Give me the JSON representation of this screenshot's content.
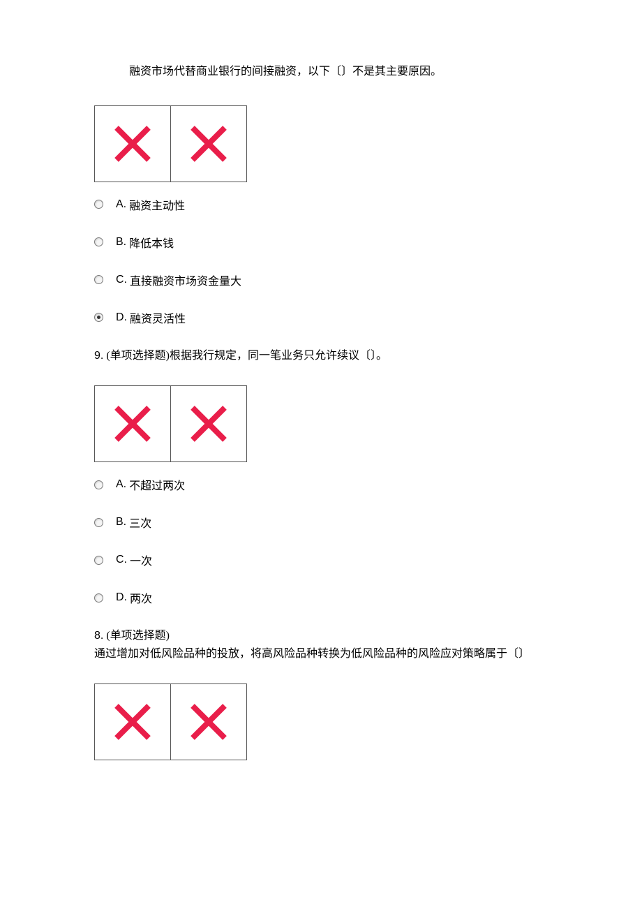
{
  "q1": {
    "intro": "融资市场代替商业银行的间接融资，以下〔〕不是其主要原因。",
    "options": [
      {
        "label": "A.",
        "text": "融资主动性",
        "selected": false
      },
      {
        "label": "B.",
        "text": "降低本钱",
        "selected": false
      },
      {
        "label": "C.",
        "text": "直接融资市场资金量大",
        "selected": false
      },
      {
        "label": "D.",
        "text": "融资灵活性",
        "selected": true
      }
    ]
  },
  "q2": {
    "number": "9.",
    "type": "(单项选择题)",
    "text": "根据我行规定，同一笔业务只允许续议〔〕。",
    "options": [
      {
        "label": "A.",
        "text": "不超过两次",
        "selected": false
      },
      {
        "label": "B.",
        "text": "三次",
        "selected": false
      },
      {
        "label": "C.",
        "text": "一次",
        "selected": false
      },
      {
        "label": "D.",
        "text": "两次",
        "selected": false
      }
    ]
  },
  "q3": {
    "number": "8.",
    "type": "(单项选择题)",
    "text": "通过增加对低风险品种的投放，将高风险品种转换为低风险品种的风险应对策略属于〔〕"
  },
  "colors": {
    "xmark": "#e91e4a"
  }
}
